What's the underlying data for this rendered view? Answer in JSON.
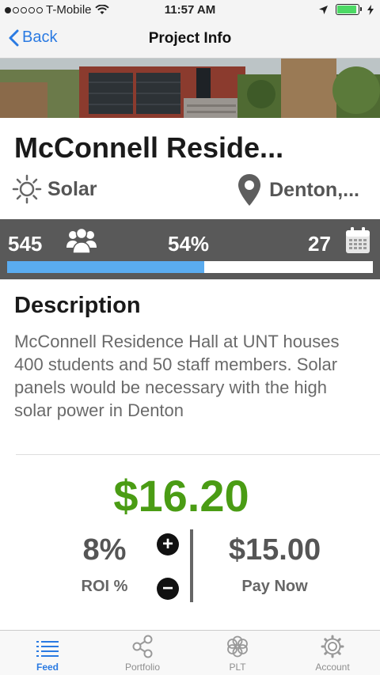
{
  "status_bar": {
    "carrier": "T-Mobile",
    "time": "11:57 AM"
  },
  "nav": {
    "back_label": "Back",
    "title": "Project Info"
  },
  "project": {
    "name": "McConnell Reside...",
    "type": "Solar",
    "location": "Denton,...",
    "backers": "545",
    "percent_label": "54%",
    "progress_fraction": 0.54,
    "days": "27"
  },
  "description": {
    "heading": "Description",
    "text": "McConnell Residence Hall at UNT houses 400 students and 50 staff members. Solar panels would be necessary with the high solar power in Denton"
  },
  "investment": {
    "price": "$16.20",
    "roi_value": "8%",
    "roi_label": "ROI %",
    "pay_value": "$15.00",
    "pay_label": "Pay Now"
  },
  "tabs": [
    {
      "label": "Feed",
      "icon": "list-icon",
      "active": true
    },
    {
      "label": "Portfolio",
      "icon": "share-icon",
      "active": false
    },
    {
      "label": "PLT",
      "icon": "flower-icon",
      "active": false
    },
    {
      "label": "Account",
      "icon": "gear-icon",
      "active": false
    }
  ],
  "colors": {
    "accent": "#2a7ae2",
    "price": "#4a9c14",
    "progress": "#5aacf0",
    "stats_bg": "#595959"
  }
}
